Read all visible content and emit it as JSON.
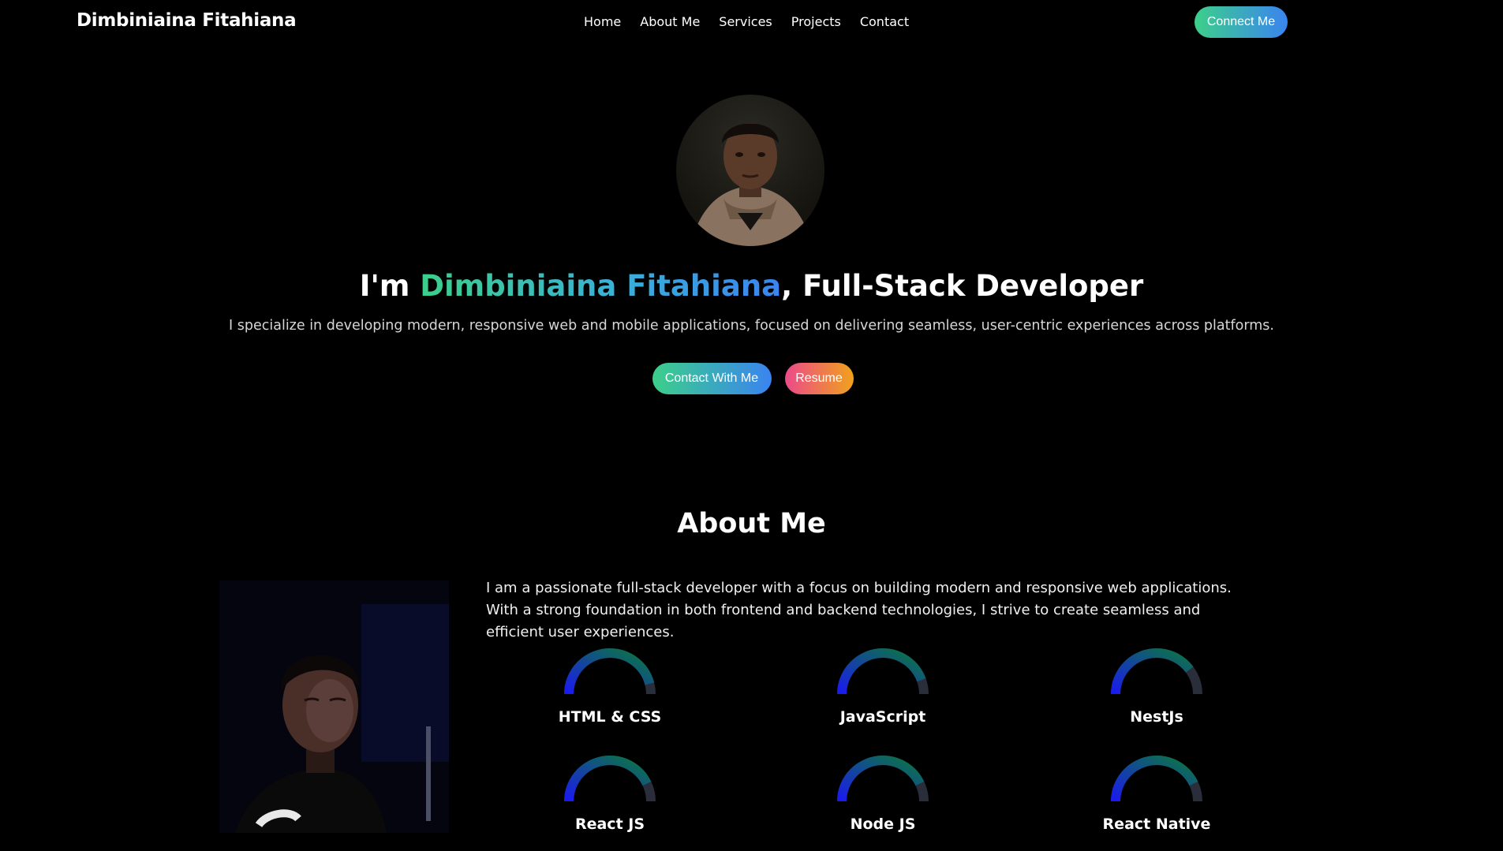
{
  "nav": {
    "brand": "Dimbiniaina Fitahiana",
    "links": [
      "Home",
      "About Me",
      "Services",
      "Projects",
      "Contact"
    ],
    "connect_label": "Connect Me"
  },
  "hero": {
    "title_prefix": "I'm ",
    "title_name": "Dimbiniaina Fitahiana",
    "title_suffix": ", Full-Stack Developer",
    "subtitle": "I specialize in developing modern, responsive web and mobile applications, focused on delivering seamless, user-centric experiences across platforms.",
    "contact_label": "Contact With Me",
    "resume_label": "Resume"
  },
  "about": {
    "heading": "About Me",
    "text": "I am a passionate full-stack developer with a focus on building modern and responsive web applications. With a strong foundation in both frontend and backend technologies, I strive to create seamless and efficient user experiences.",
    "skills": [
      {
        "label": "HTML & CSS"
      },
      {
        "label": "JavaScript"
      },
      {
        "label": "NestJs"
      },
      {
        "label": "React JS"
      },
      {
        "label": "Node JS"
      },
      {
        "label": "React Native"
      }
    ]
  },
  "colors": {
    "accent_green": "#3ccf8a",
    "accent_blue": "#3a84f0",
    "accent_pink": "#ec4a8a",
    "accent_orange": "#f0a21c",
    "background": "#000000"
  }
}
